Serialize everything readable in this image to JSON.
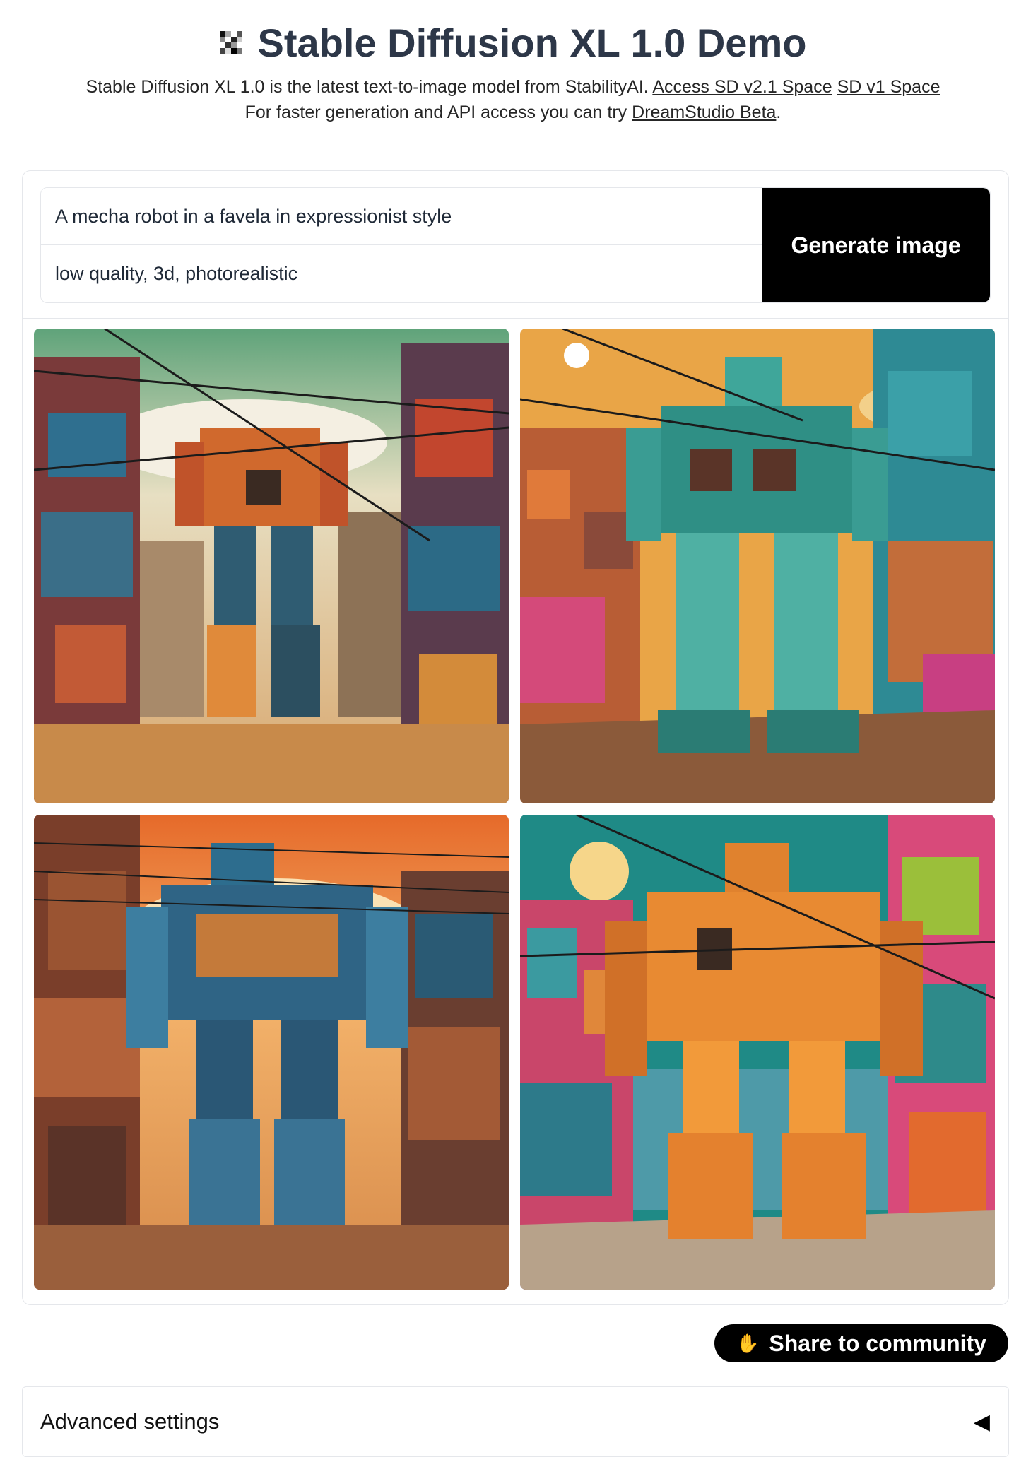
{
  "header": {
    "title": "Stable Diffusion XL 1.0 Demo",
    "subtitle_text": "Stable Diffusion XL 1.0 is the latest text-to-image model from StabilityAI.",
    "link_sd21": "Access SD v2.1 Space",
    "link_sd1": "SD v1 Space",
    "line2_prefix": "For faster generation and API access you can try",
    "link_dreamstudio": "DreamStudio Beta",
    "line2_suffix": "."
  },
  "prompt": {
    "positive_value": "A mecha robot in a favela in expressionist style",
    "negative_value": "low quality, 3d, photorealistic",
    "generate_label": "Generate image"
  },
  "gallery": {
    "images": [
      {
        "theme": "green-sky orange robot"
      },
      {
        "theme": "orange-sky teal robot"
      },
      {
        "theme": "orange-sky blue robot"
      },
      {
        "theme": "teal-sky orange robot"
      }
    ]
  },
  "share": {
    "label": "Share to community",
    "icon": "hands-icon"
  },
  "advanced": {
    "label": "Advanced settings",
    "icon": "caret-left-icon"
  }
}
